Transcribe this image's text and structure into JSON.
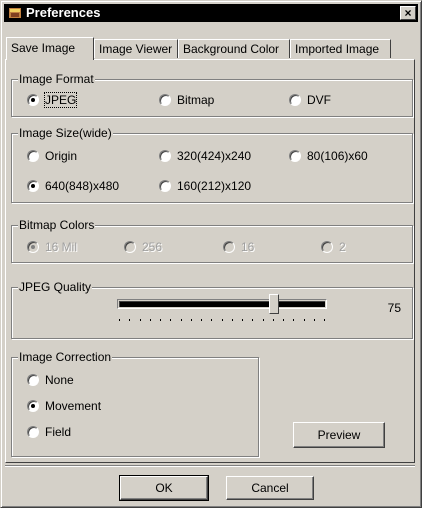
{
  "window": {
    "title": "Preferences",
    "close_label": "×",
    "icon": "app-icon"
  },
  "tabs": [
    {
      "label": "Save Image",
      "active": true
    },
    {
      "label": "Image Viewer",
      "active": false
    },
    {
      "label": "Background Color",
      "active": false
    },
    {
      "label": "Imported Image",
      "active": false
    }
  ],
  "image_format": {
    "label": "Image Format",
    "options": [
      {
        "label": "JPEG",
        "checked": true
      },
      {
        "label": "Bitmap",
        "checked": false
      },
      {
        "label": "DVF",
        "checked": false
      }
    ]
  },
  "image_size": {
    "label": "Image Size(wide)",
    "options": [
      {
        "label": "Origin",
        "checked": false
      },
      {
        "label": "320(424)x240",
        "checked": false
      },
      {
        "label": "80(106)x60",
        "checked": false
      },
      {
        "label": "640(848)x480",
        "checked": true
      },
      {
        "label": "160(212)x120",
        "checked": false
      }
    ]
  },
  "bitmap_colors": {
    "label": "Bitmap Colors",
    "disabled": true,
    "options": [
      {
        "label": "16 Mil",
        "checked": true
      },
      {
        "label": "256",
        "checked": false
      },
      {
        "label": "16",
        "checked": false
      },
      {
        "label": "2",
        "checked": false
      }
    ]
  },
  "jpeg_quality": {
    "label": "JPEG Quality",
    "value": "75",
    "level": 0.75
  },
  "image_correction": {
    "label": "Image Correction",
    "options": [
      {
        "label": "None",
        "checked": false
      },
      {
        "label": "Movement",
        "checked": true
      },
      {
        "label": "Field",
        "checked": false
      }
    ]
  },
  "buttons": {
    "preview": "Preview",
    "ok": "OK",
    "cancel": "Cancel"
  }
}
